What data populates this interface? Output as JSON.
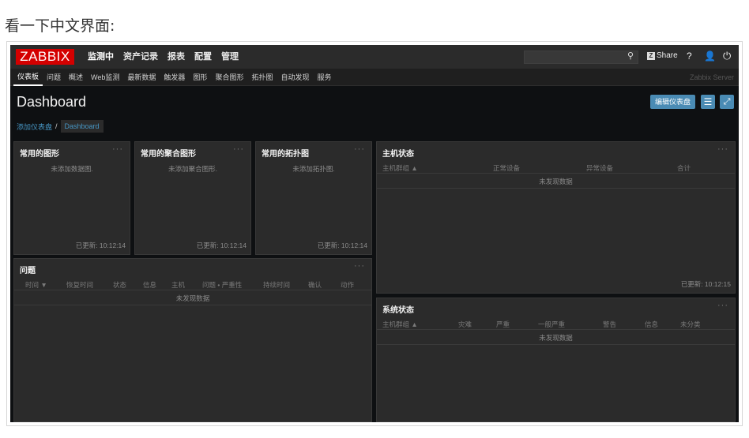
{
  "caption": "看一下中文界面:",
  "logo": "ZABBIX",
  "main_menu": [
    "监测中",
    "资产记录",
    "报表",
    "配置",
    "管理"
  ],
  "search_placeholder": "",
  "share_label": "Share",
  "help_label": "?",
  "sub_menu": [
    "仪表板",
    "问题",
    "概述",
    "Web监测",
    "最新数据",
    "触发器",
    "图形",
    "聚合图形",
    "拓扑图",
    "自动发现",
    "服务"
  ],
  "server_name": "Zabbix Server",
  "page_title": "Dashboard",
  "buttons": {
    "edit_dashboard": "编辑仪表盘"
  },
  "breadcrumb": {
    "link": "添加仪表盘",
    "separator": "/",
    "current": "Dashboard"
  },
  "widgets": {
    "graphs": {
      "title": "常用的图形",
      "dots": "···",
      "message": "未添加数据图.",
      "updated": "已更新: 10:12:14"
    },
    "screens": {
      "title": "常用的聚合图形",
      "dots": "···",
      "message": "未添加聚合图形.",
      "updated": "已更新: 10:12:14"
    },
    "maps": {
      "title": "常用的拓扑图",
      "dots": "···",
      "message": "未添加拓扑图.",
      "updated": "已更新: 10:12:14"
    },
    "host_status": {
      "title": "主机状态",
      "dots": "···",
      "columns": [
        "主机群组 ▲",
        "正常设备",
        "异常设备",
        "合计"
      ],
      "empty": "未发现数据",
      "updated": "已更新: 10:12:15"
    },
    "problems": {
      "title": "问题",
      "dots": "···",
      "columns": [
        "时间 ▼",
        "恢复时间",
        "状态",
        "信息",
        "主机",
        "问题 • 严重性",
        "持续时间",
        "确认",
        "动作"
      ],
      "empty": "未发现数据"
    },
    "system_status": {
      "title": "系统状态",
      "dots": "···",
      "columns": [
        "主机群组 ▲",
        "灾难",
        "严重",
        "一般严重",
        "警告",
        "信息",
        "未分类"
      ],
      "empty": "未发现数据"
    }
  },
  "colors": {
    "logo_red": "#d40000",
    "accent_blue": "#4a8bb4",
    "link_blue": "#4796c4",
    "widget_bg": "#2b2b2b",
    "page_bg": "#0e1012"
  }
}
